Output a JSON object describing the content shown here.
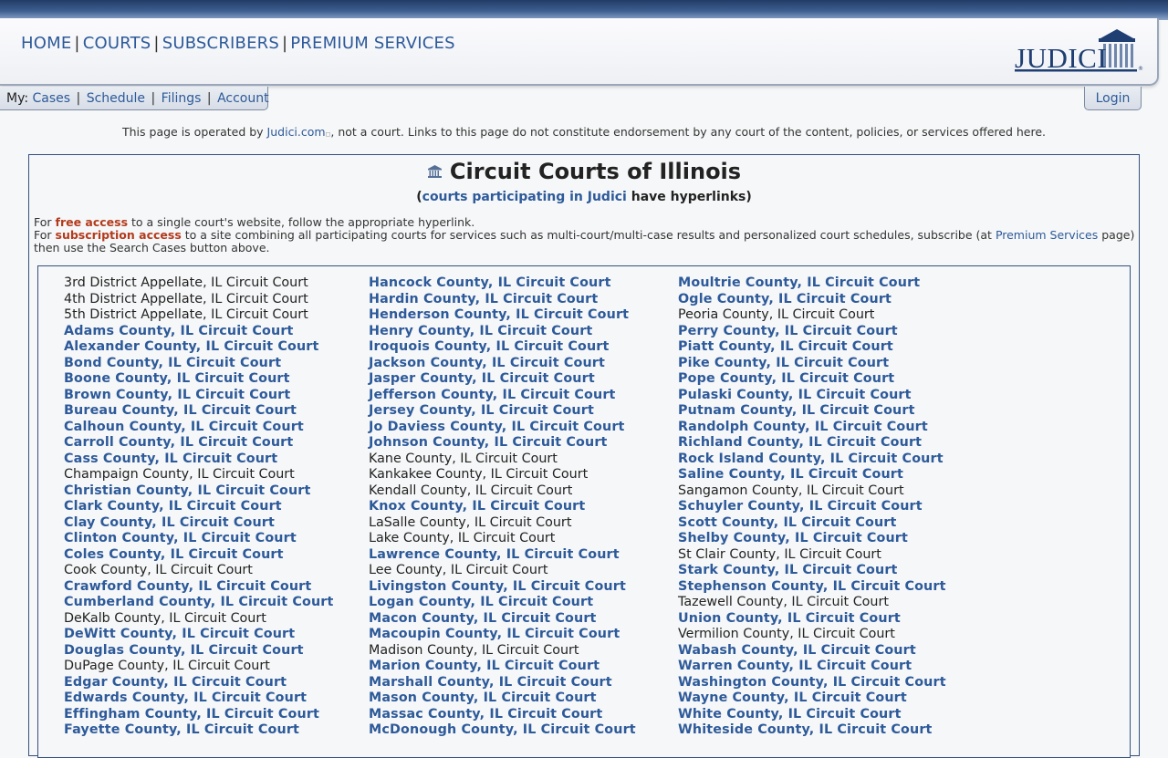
{
  "nav": {
    "items": [
      "HOME",
      "COURTS",
      "SUBSCRIBERS",
      "PREMIUM SERVICES"
    ],
    "logo_text": "JUDICI"
  },
  "my_bar": {
    "prefix": "My:",
    "links": [
      "Cases",
      "Schedule",
      "Filings",
      "Account"
    ],
    "login": "Login"
  },
  "notice": {
    "before": "This page is operated by ",
    "link": "Judici.com",
    "after": ", not a court. Links to this page do not constitute endorsement by any court of the content, policies, or services offered here."
  },
  "page": {
    "title": "Circuit Courts of Illinois",
    "subtitle_open": "(",
    "subtitle_link": "courts participating in Judici",
    "subtitle_rest": " have hyperlinks)",
    "intro_line1_a": "For ",
    "intro_line1_free": "free access",
    "intro_line1_b": " to a single court's website, follow the appropriate hyperlink.",
    "intro_line2_a": "For ",
    "intro_line2_sub": "subscription access",
    "intro_line2_b": " to a site combining all participating courts for services such as multi-court/multi-case results and personalized court schedules, subscribe (at ",
    "intro_line2_link": "Premium Services",
    "intro_line2_c": " page) then use the Search Cases button above."
  },
  "courts": {
    "col1": [
      {
        "name": "3rd District Appellate, IL Circuit Court",
        "link": false
      },
      {
        "name": "4th District Appellate, IL Circuit Court",
        "link": false
      },
      {
        "name": "5th District Appellate, IL Circuit Court",
        "link": false
      },
      {
        "name": "Adams County, IL Circuit Court",
        "link": true
      },
      {
        "name": "Alexander County, IL Circuit Court",
        "link": true
      },
      {
        "name": "Bond County, IL Circuit Court",
        "link": true
      },
      {
        "name": "Boone County, IL Circuit Court",
        "link": true
      },
      {
        "name": "Brown County, IL Circuit Court",
        "link": true
      },
      {
        "name": "Bureau County, IL Circuit Court",
        "link": true
      },
      {
        "name": "Calhoun County, IL Circuit Court",
        "link": true
      },
      {
        "name": "Carroll County, IL Circuit Court",
        "link": true
      },
      {
        "name": "Cass County, IL Circuit Court",
        "link": true
      },
      {
        "name": "Champaign County, IL Circuit Court",
        "link": false
      },
      {
        "name": "Christian County, IL Circuit Court",
        "link": true
      },
      {
        "name": "Clark County, IL Circuit Court",
        "link": true
      },
      {
        "name": "Clay County, IL Circuit Court",
        "link": true
      },
      {
        "name": "Clinton County, IL Circuit Court",
        "link": true
      },
      {
        "name": "Coles County, IL Circuit Court",
        "link": true
      },
      {
        "name": "Cook County, IL Circuit Court",
        "link": false
      },
      {
        "name": "Crawford County, IL Circuit Court",
        "link": true
      },
      {
        "name": "Cumberland County, IL Circuit Court",
        "link": true
      },
      {
        "name": "DeKalb County, IL Circuit Court",
        "link": false
      },
      {
        "name": "DeWitt County, IL Circuit Court",
        "link": true
      },
      {
        "name": "Douglas County, IL Circuit Court",
        "link": true
      },
      {
        "name": "DuPage County, IL Circuit Court",
        "link": false
      },
      {
        "name": "Edgar County, IL Circuit Court",
        "link": true
      },
      {
        "name": "Edwards County, IL Circuit Court",
        "link": true
      },
      {
        "name": "Effingham County, IL Circuit Court",
        "link": true
      },
      {
        "name": "Fayette County, IL Circuit Court",
        "link": true
      }
    ],
    "col2": [
      {
        "name": "Hancock County, IL Circuit Court",
        "link": true
      },
      {
        "name": "Hardin County, IL Circuit Court",
        "link": true
      },
      {
        "name": "Henderson County, IL Circuit Court",
        "link": true
      },
      {
        "name": "Henry County, IL Circuit Court",
        "link": true
      },
      {
        "name": "Iroquois County, IL Circuit Court",
        "link": true
      },
      {
        "name": "Jackson County, IL Circuit Court",
        "link": true
      },
      {
        "name": "Jasper County, IL Circuit Court",
        "link": true
      },
      {
        "name": "Jefferson County, IL Circuit Court",
        "link": true
      },
      {
        "name": "Jersey County, IL Circuit Court",
        "link": true
      },
      {
        "name": "Jo Daviess County, IL Circuit Court",
        "link": true
      },
      {
        "name": "Johnson County, IL Circuit Court",
        "link": true
      },
      {
        "name": "Kane County, IL Circuit Court",
        "link": false
      },
      {
        "name": "Kankakee County, IL Circuit Court",
        "link": false
      },
      {
        "name": "Kendall County, IL Circuit Court",
        "link": false
      },
      {
        "name": "Knox County, IL Circuit Court",
        "link": true
      },
      {
        "name": "LaSalle County, IL Circuit Court",
        "link": false
      },
      {
        "name": "Lake County, IL Circuit Court",
        "link": false
      },
      {
        "name": "Lawrence County, IL Circuit Court",
        "link": true
      },
      {
        "name": "Lee County, IL Circuit Court",
        "link": false
      },
      {
        "name": "Livingston County, IL Circuit Court",
        "link": true
      },
      {
        "name": "Logan County, IL Circuit Court",
        "link": true
      },
      {
        "name": "Macon County, IL Circuit Court",
        "link": true
      },
      {
        "name": "Macoupin County, IL Circuit Court",
        "link": true
      },
      {
        "name": "Madison County, IL Circuit Court",
        "link": false
      },
      {
        "name": "Marion County, IL Circuit Court",
        "link": true
      },
      {
        "name": "Marshall County, IL Circuit Court",
        "link": true
      },
      {
        "name": "Mason County, IL Circuit Court",
        "link": true
      },
      {
        "name": "Massac County, IL Circuit Court",
        "link": true
      },
      {
        "name": "McDonough County, IL Circuit Court",
        "link": true
      }
    ],
    "col3": [
      {
        "name": "Moultrie County, IL Circuit Court",
        "link": true
      },
      {
        "name": "Ogle County, IL Circuit Court",
        "link": true
      },
      {
        "name": "Peoria County, IL Circuit Court",
        "link": false
      },
      {
        "name": "Perry County, IL Circuit Court",
        "link": true
      },
      {
        "name": "Piatt County, IL Circuit Court",
        "link": true
      },
      {
        "name": "Pike County, IL Circuit Court",
        "link": true
      },
      {
        "name": "Pope County, IL Circuit Court",
        "link": true
      },
      {
        "name": "Pulaski County, IL Circuit Court",
        "link": true
      },
      {
        "name": "Putnam County, IL Circuit Court",
        "link": true
      },
      {
        "name": "Randolph County, IL Circuit Court",
        "link": true
      },
      {
        "name": "Richland County, IL Circuit Court",
        "link": true
      },
      {
        "name": "Rock Island County, IL Circuit Court",
        "link": true
      },
      {
        "name": "Saline County, IL Circuit Court",
        "link": true
      },
      {
        "name": "Sangamon County, IL Circuit Court",
        "link": false
      },
      {
        "name": "Schuyler County, IL Circuit Court",
        "link": true
      },
      {
        "name": "Scott County, IL Circuit Court",
        "link": true
      },
      {
        "name": "Shelby County, IL Circuit Court",
        "link": true
      },
      {
        "name": "St Clair County, IL Circuit Court",
        "link": false
      },
      {
        "name": "Stark County, IL Circuit Court",
        "link": true
      },
      {
        "name": "Stephenson County, IL Circuit Court",
        "link": true
      },
      {
        "name": "Tazewell County, IL Circuit Court",
        "link": false
      },
      {
        "name": "Union County, IL Circuit Court",
        "link": true
      },
      {
        "name": "Vermilion County, IL Circuit Court",
        "link": false
      },
      {
        "name": "Wabash County, IL Circuit Court",
        "link": true
      },
      {
        "name": "Warren County, IL Circuit Court",
        "link": true
      },
      {
        "name": "Washington County, IL Circuit Court",
        "link": true
      },
      {
        "name": "Wayne County, IL Circuit Court",
        "link": true
      },
      {
        "name": "White County, IL Circuit Court",
        "link": true
      },
      {
        "name": "Whiteside County, IL Circuit Court",
        "link": true
      }
    ]
  },
  "colors": {
    "link": "#2d5a9a",
    "accent_red": "#b33b1c",
    "border": "#34507e"
  }
}
